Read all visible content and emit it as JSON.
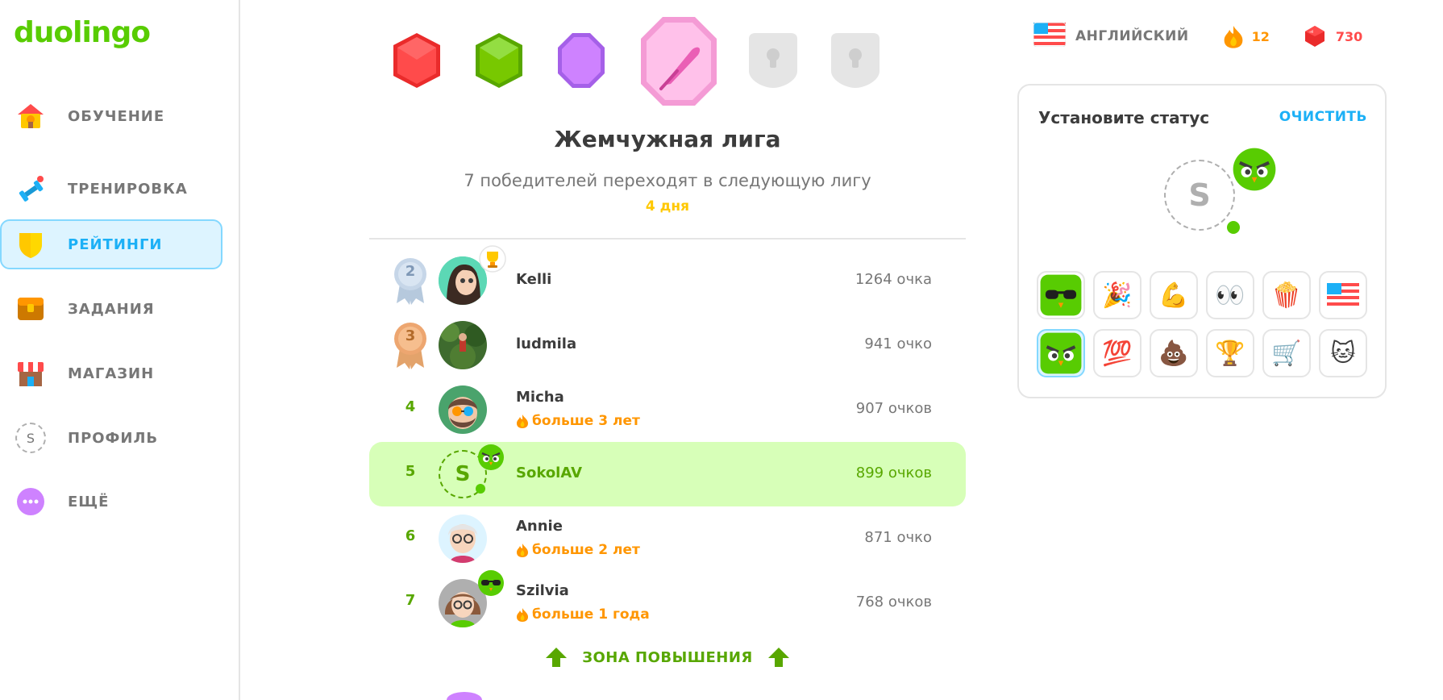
{
  "app": {
    "logo": "duolingo"
  },
  "sidebar": {
    "items": [
      {
        "label": "ОБУЧЕНИЕ",
        "icon": "home-icon",
        "active": false
      },
      {
        "label": "ТРЕНИРОВКА",
        "icon": "dumbbell-icon",
        "active": false
      },
      {
        "label": "РЕЙТИНГИ",
        "icon": "shield-icon",
        "active": true
      },
      {
        "label": "ЗАДАНИЯ",
        "icon": "chest-icon",
        "active": false
      },
      {
        "label": "МАГАЗИН",
        "icon": "shop-icon",
        "active": false
      },
      {
        "label": "ПРОФИЛЬ",
        "icon": "profile-icon",
        "avatar_letter": "S",
        "active": false
      },
      {
        "label": "ЕЩЁ",
        "icon": "more-icon",
        "active": false
      }
    ]
  },
  "league": {
    "title": "Жемчужная лига",
    "subtitle": "7 победителей переходят в следующую лигу",
    "days_left": "4 дня",
    "badges": [
      "ruby",
      "emerald",
      "amethyst",
      "pearl",
      "locked",
      "locked"
    ]
  },
  "leaderboard": [
    {
      "rank": "2",
      "name": "Kelli",
      "points": "1264 очка",
      "streak": "",
      "medal": "silver"
    },
    {
      "rank": "3",
      "name": "ludmila",
      "points": "941 очко",
      "streak": "",
      "medal": "bronze"
    },
    {
      "rank": "4",
      "name": "Micha",
      "points": "907 очков",
      "streak": "больше 3 лет"
    },
    {
      "rank": "5",
      "name": "SokolAV",
      "points": "899 очков",
      "streak": "",
      "avatar_letter": "S",
      "current_user": true
    },
    {
      "rank": "6",
      "name": "Annie",
      "points": "871 очко",
      "streak": "больше 2 лет"
    },
    {
      "rank": "7",
      "name": "Szilvia",
      "points": "768 очков",
      "streak": "больше 1 года"
    }
  ],
  "promotion_zone": {
    "label": "ЗОНА ПОВЫШЕНИЯ"
  },
  "topbar": {
    "course": "АНГЛИЙСКИЙ",
    "streak": "12",
    "gems": "730"
  },
  "status": {
    "title": "Установите статус",
    "clear": "ОЧИСТИТЬ",
    "avatar_letter": "S",
    "emojis": [
      {
        "name": "duo-sunglasses",
        "glyph": "🕶"
      },
      {
        "name": "party-popper",
        "glyph": "🎉"
      },
      {
        "name": "flexed-biceps",
        "glyph": "💪"
      },
      {
        "name": "eyes",
        "glyph": "👀"
      },
      {
        "name": "popcorn",
        "glyph": "🍿"
      },
      {
        "name": "us-flag",
        "glyph": ""
      },
      {
        "name": "duo-angry",
        "glyph": "",
        "selected": true
      },
      {
        "name": "hundred-points",
        "glyph": "💯"
      },
      {
        "name": "pile-of-poo",
        "glyph": "💩"
      },
      {
        "name": "trophy",
        "glyph": "🏆"
      },
      {
        "name": "money-cart",
        "glyph": "🛒"
      },
      {
        "name": "grumpy-cat",
        "glyph": "🐱"
      }
    ]
  },
  "colors": {
    "brand": "#58cc02",
    "accent_blue": "#1cb0f6",
    "promotion_bg": "#d7ffb8",
    "streak_orange": "#ff9600",
    "gem_red": "#ff4b4b",
    "gold": "#ffc800"
  }
}
